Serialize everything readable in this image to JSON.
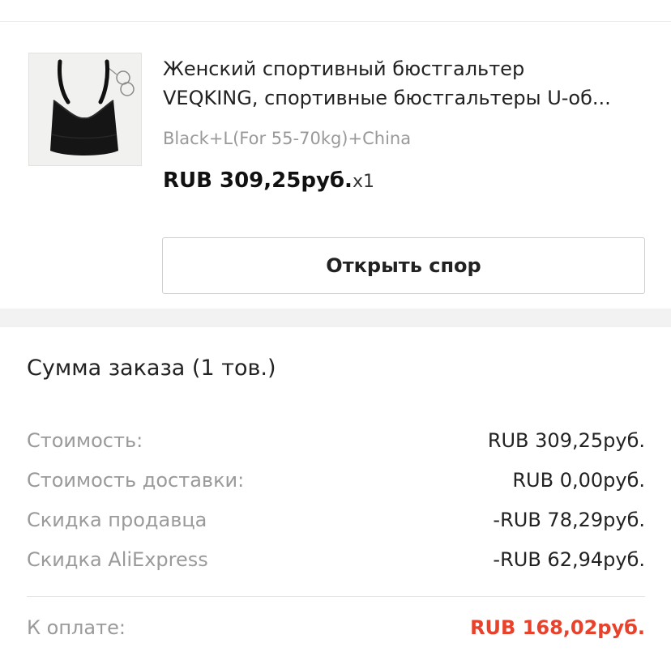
{
  "colors": {
    "total_accent": "#e8422c",
    "text_primary": "#222222",
    "text_muted": "#9a9a9a",
    "divider": "#e5e5e5",
    "section_gap": "#f2f2f2"
  },
  "product": {
    "image_icon": "sports-bra-product-photo",
    "title_line1": "Женский спортивный бюстгальтер",
    "title_line2": "VEQKING, спортивные бюстгальтеры U-об...",
    "variant": "Black+L(For 55-70kg)+China",
    "price": "RUB 309,25руб.",
    "quantity": "x1",
    "dispute_button_label": "Открыть спор"
  },
  "summary": {
    "title": "Сумма заказа (1 тов.)",
    "rows": [
      {
        "label": "Стоимость:",
        "value": "RUB 309,25руб."
      },
      {
        "label": "Стоимость доставки:",
        "value": "RUB 0,00руб."
      },
      {
        "label": "Скидка продавца",
        "value": "-RUB 78,29руб."
      },
      {
        "label": "Скидка AliExpress",
        "value": "-RUB 62,94руб."
      }
    ],
    "total_label": "К оплате:",
    "total_value": "RUB 168,02руб."
  }
}
